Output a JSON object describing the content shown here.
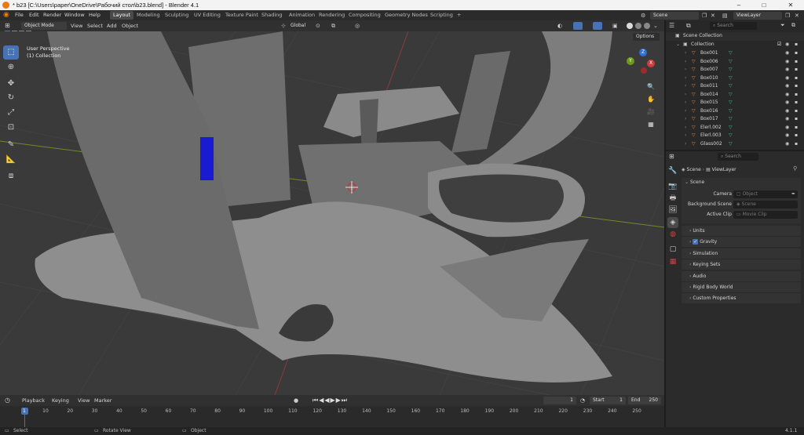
{
  "window": {
    "title": "* b23 [C:\\Users\\paper\\OneDrive\\Рабочий стол\\b23.blend] - Blender 4.1",
    "minimize": "–",
    "maximize": "□",
    "close": "✕"
  },
  "menu": [
    "File",
    "Edit",
    "Render",
    "Window",
    "Help"
  ],
  "workspaces": [
    "Layout",
    "Modeling",
    "Sculpting",
    "UV Editing",
    "Texture Paint",
    "Shading",
    "Animation",
    "Rendering",
    "Compositing",
    "Geometry Nodes",
    "Scripting"
  ],
  "workspace_add": "+",
  "scene_field": "Scene",
  "viewlayer_field": "ViewLayer",
  "viewport_header": {
    "mode": "Object Mode",
    "menus": [
      "View",
      "Select",
      "Add",
      "Object"
    ],
    "orientation": "Global",
    "options": "Options"
  },
  "viewport_overlay": {
    "line1": "User Perspective",
    "line2": "(1) Collection"
  },
  "gizmo": {
    "z": "Z",
    "y": "Y",
    "x": "X"
  },
  "timeline_header": {
    "menus": [
      "Playback",
      "Keying",
      "View",
      "Marker"
    ],
    "current_frame": "1",
    "start_label": "Start",
    "start": "1",
    "end_label": "End",
    "end": "250"
  },
  "timeline_ticks": [
    "1",
    "10",
    "20",
    "30",
    "40",
    "50",
    "60",
    "70",
    "80",
    "90",
    "100",
    "110",
    "120",
    "130",
    "140",
    "150",
    "160",
    "170",
    "180",
    "190",
    "200",
    "210",
    "220",
    "230",
    "240",
    "250"
  ],
  "status": {
    "select": "Select",
    "rotate": "Rotate View",
    "object": "Object",
    "version": "4.1.1"
  },
  "outliner": {
    "search": "Search",
    "scene_collection": "Scene Collection",
    "collection": "Collection",
    "items": [
      "Box001",
      "Box006",
      "Box007",
      "Box010",
      "Box011",
      "Box014",
      "Box015",
      "Box016",
      "Box017",
      "Elerl.002",
      "Elerl.003",
      "Glass002"
    ]
  },
  "properties": {
    "search": "Search",
    "breadcrumb_scene": "Scene",
    "breadcrumb_layer": "ViewLayer",
    "section": "Scene",
    "camera_label": "Camera",
    "camera_ph": "Object",
    "bg_label": "Background Scene",
    "bg_ph": "Scene",
    "clip_label": "Active Clip",
    "clip_ph": "Movie Clip",
    "panels": [
      "Units",
      "Gravity",
      "Simulation",
      "Keying Sets",
      "Audio",
      "Rigid Body World",
      "Custom Properties"
    ]
  },
  "colors": {
    "accent": "#4772b3",
    "active_frame": "#4772b3",
    "mesh": "#7a7a7a",
    "grid_x": "#8c3b3b",
    "grid_y": "#6c8a2a"
  }
}
